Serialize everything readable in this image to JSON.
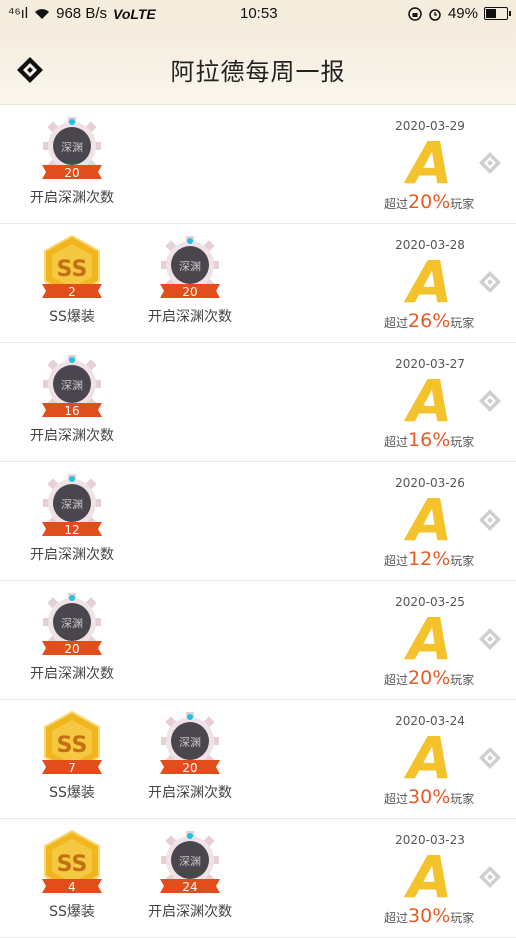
{
  "status_bar": {
    "signal": "⁴⁶ıl",
    "speed": "968 B/s",
    "volte": "VoLTE",
    "time": "10:53",
    "battery": "49%"
  },
  "header": {
    "title": "阿拉德每周一报"
  },
  "colors": {
    "grade": "#f4c22a",
    "accent": "#e85a23",
    "ribbon": "#e24e1b"
  },
  "rows": [
    {
      "date": "2020-03-29",
      "grade": "A",
      "prefix": "超过",
      "percent": "20%",
      "suffix": "玩家",
      "badges": [
        {
          "type": "abyss",
          "count": "20",
          "label": "开启深渊次数",
          "icon_text": "深渊"
        }
      ]
    },
    {
      "date": "2020-03-28",
      "grade": "A",
      "prefix": "超过",
      "percent": "26%",
      "suffix": "玩家",
      "badges": [
        {
          "type": "ss",
          "count": "2",
          "label": "SS爆装",
          "icon_text": "SS"
        },
        {
          "type": "abyss",
          "count": "20",
          "label": "开启深渊次数",
          "icon_text": "深渊"
        }
      ]
    },
    {
      "date": "2020-03-27",
      "grade": "A",
      "prefix": "超过",
      "percent": "16%",
      "suffix": "玩家",
      "badges": [
        {
          "type": "abyss",
          "count": "16",
          "label": "开启深渊次数",
          "icon_text": "深渊"
        }
      ]
    },
    {
      "date": "2020-03-26",
      "grade": "A",
      "prefix": "超过",
      "percent": "12%",
      "suffix": "玩家",
      "badges": [
        {
          "type": "abyss",
          "count": "12",
          "label": "开启深渊次数",
          "icon_text": "深渊"
        }
      ]
    },
    {
      "date": "2020-03-25",
      "grade": "A",
      "prefix": "超过",
      "percent": "20%",
      "suffix": "玩家",
      "badges": [
        {
          "type": "abyss",
          "count": "20",
          "label": "开启深渊次数",
          "icon_text": "深渊"
        }
      ]
    },
    {
      "date": "2020-03-24",
      "grade": "A",
      "prefix": "超过",
      "percent": "30%",
      "suffix": "玩家",
      "badges": [
        {
          "type": "ss",
          "count": "7",
          "label": "SS爆装",
          "icon_text": "SS"
        },
        {
          "type": "abyss",
          "count": "20",
          "label": "开启深渊次数",
          "icon_text": "深渊"
        }
      ]
    },
    {
      "date": "2020-03-23",
      "grade": "A",
      "prefix": "超过",
      "percent": "30%",
      "suffix": "玩家",
      "badges": [
        {
          "type": "ss",
          "count": "4",
          "label": "SS爆装",
          "icon_text": "SS"
        },
        {
          "type": "abyss",
          "count": "24",
          "label": "开启深渊次数",
          "icon_text": "深渊"
        }
      ]
    }
  ]
}
